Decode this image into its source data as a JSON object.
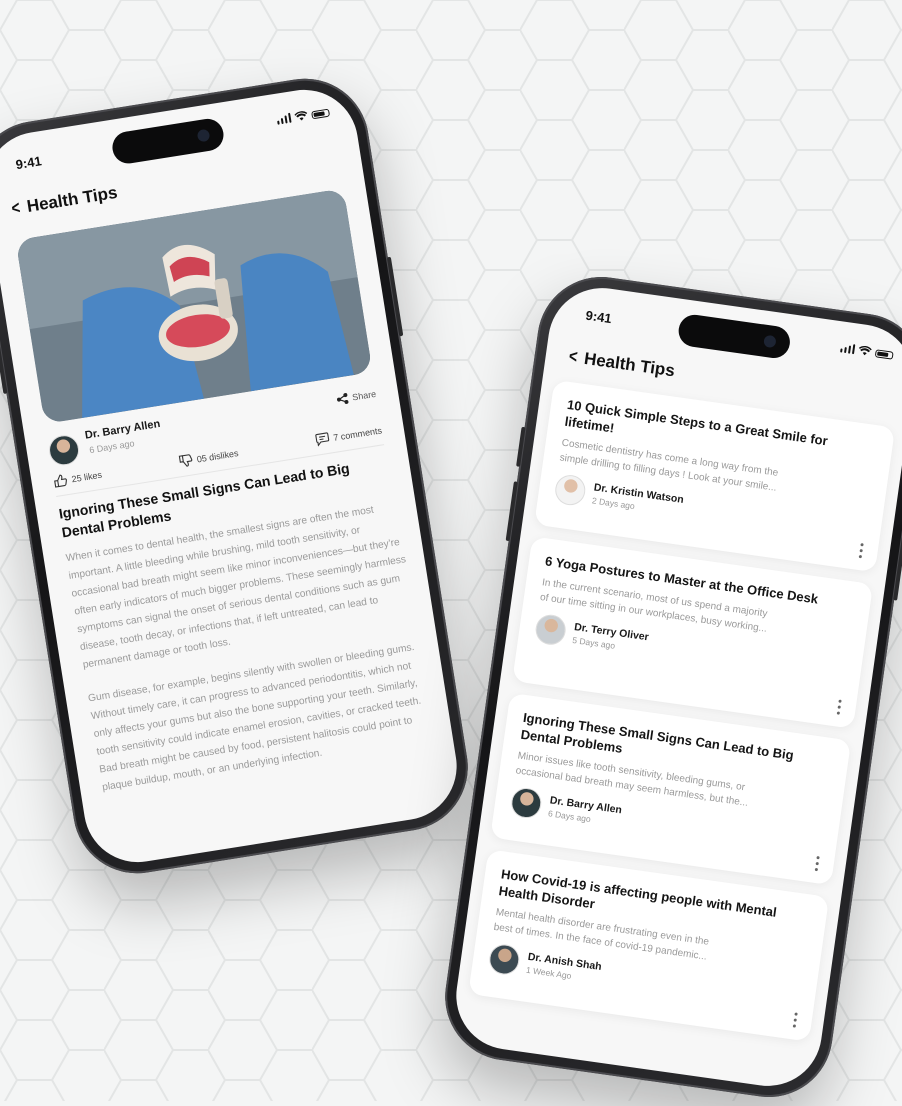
{
  "status": {
    "time": "9:41"
  },
  "screen1": {
    "nav_title": "Health Tips",
    "author": {
      "name": "Dr. Barry Allen",
      "time": "6 Days ago"
    },
    "share_label": "Share",
    "stats": {
      "likes": "25 likes",
      "dislikes": "05 dislikes",
      "comments": "7 comments"
    },
    "article_title": "Ignoring These Small Signs Can Lead to Big Dental Problems",
    "paragraphs": [
      "When it comes to dental health, the smallest signs are often the most important. A little bleeding while brushing, mild tooth sensitivity, or occasional bad breath might seem like minor inconveniences—but they're often early indicators of much bigger problems. These seemingly harmless symptoms can signal the onset of serious dental conditions such as gum disease, tooth decay, or infections that, if left untreated, can lead to permanent damage or tooth loss.",
      "Gum disease, for example, begins silently with swollen or bleeding gums. Without timely care, it can progress to advanced periodontitis, which not only affects your gums but also the bone supporting your teeth. Similarly, tooth sensitivity could indicate enamel erosion, cavities, or cracked teeth. Bad breath might be caused by food, persistent halitosis could point to plaque buildup, mouth, or an underlying infection."
    ]
  },
  "screen2": {
    "nav_title": "Health Tips",
    "cards": [
      {
        "title": "10 Quick Simple Steps to a Great Smile for lifetime!",
        "excerpt1": "Cosmetic dentistry has come a long way from the",
        "excerpt2": "simple drilling to filling days ! Look at your smile...",
        "author": "Dr. Kristin Watson",
        "time": "2 Days ago"
      },
      {
        "title": "6 Yoga Postures to Master at the Office Desk",
        "excerpt1": "In the current scenario, most of us spend a majority",
        "excerpt2": "of our time sitting in our workplaces, busy working...",
        "author": "Dr. Terry Oliver",
        "time": "5 Days ago"
      },
      {
        "title": "Ignoring These Small Signs Can Lead to Big Dental Problems",
        "excerpt1": "Minor issues like tooth sensitivity, bleeding gums, or",
        "excerpt2": "occasional bad breath may seem harmless, but the...",
        "author": "Dr. Barry Allen",
        "time": "6 Days ago"
      },
      {
        "title": "How Covid-19 is affecting people with Mental Health Disorder",
        "excerpt1": "Mental health disorder are frustrating even in the",
        "excerpt2": "best of times. In the face of covid-19 pandemic...",
        "author": "Dr. Anish Shah",
        "time": "1 Week Ago"
      }
    ]
  }
}
